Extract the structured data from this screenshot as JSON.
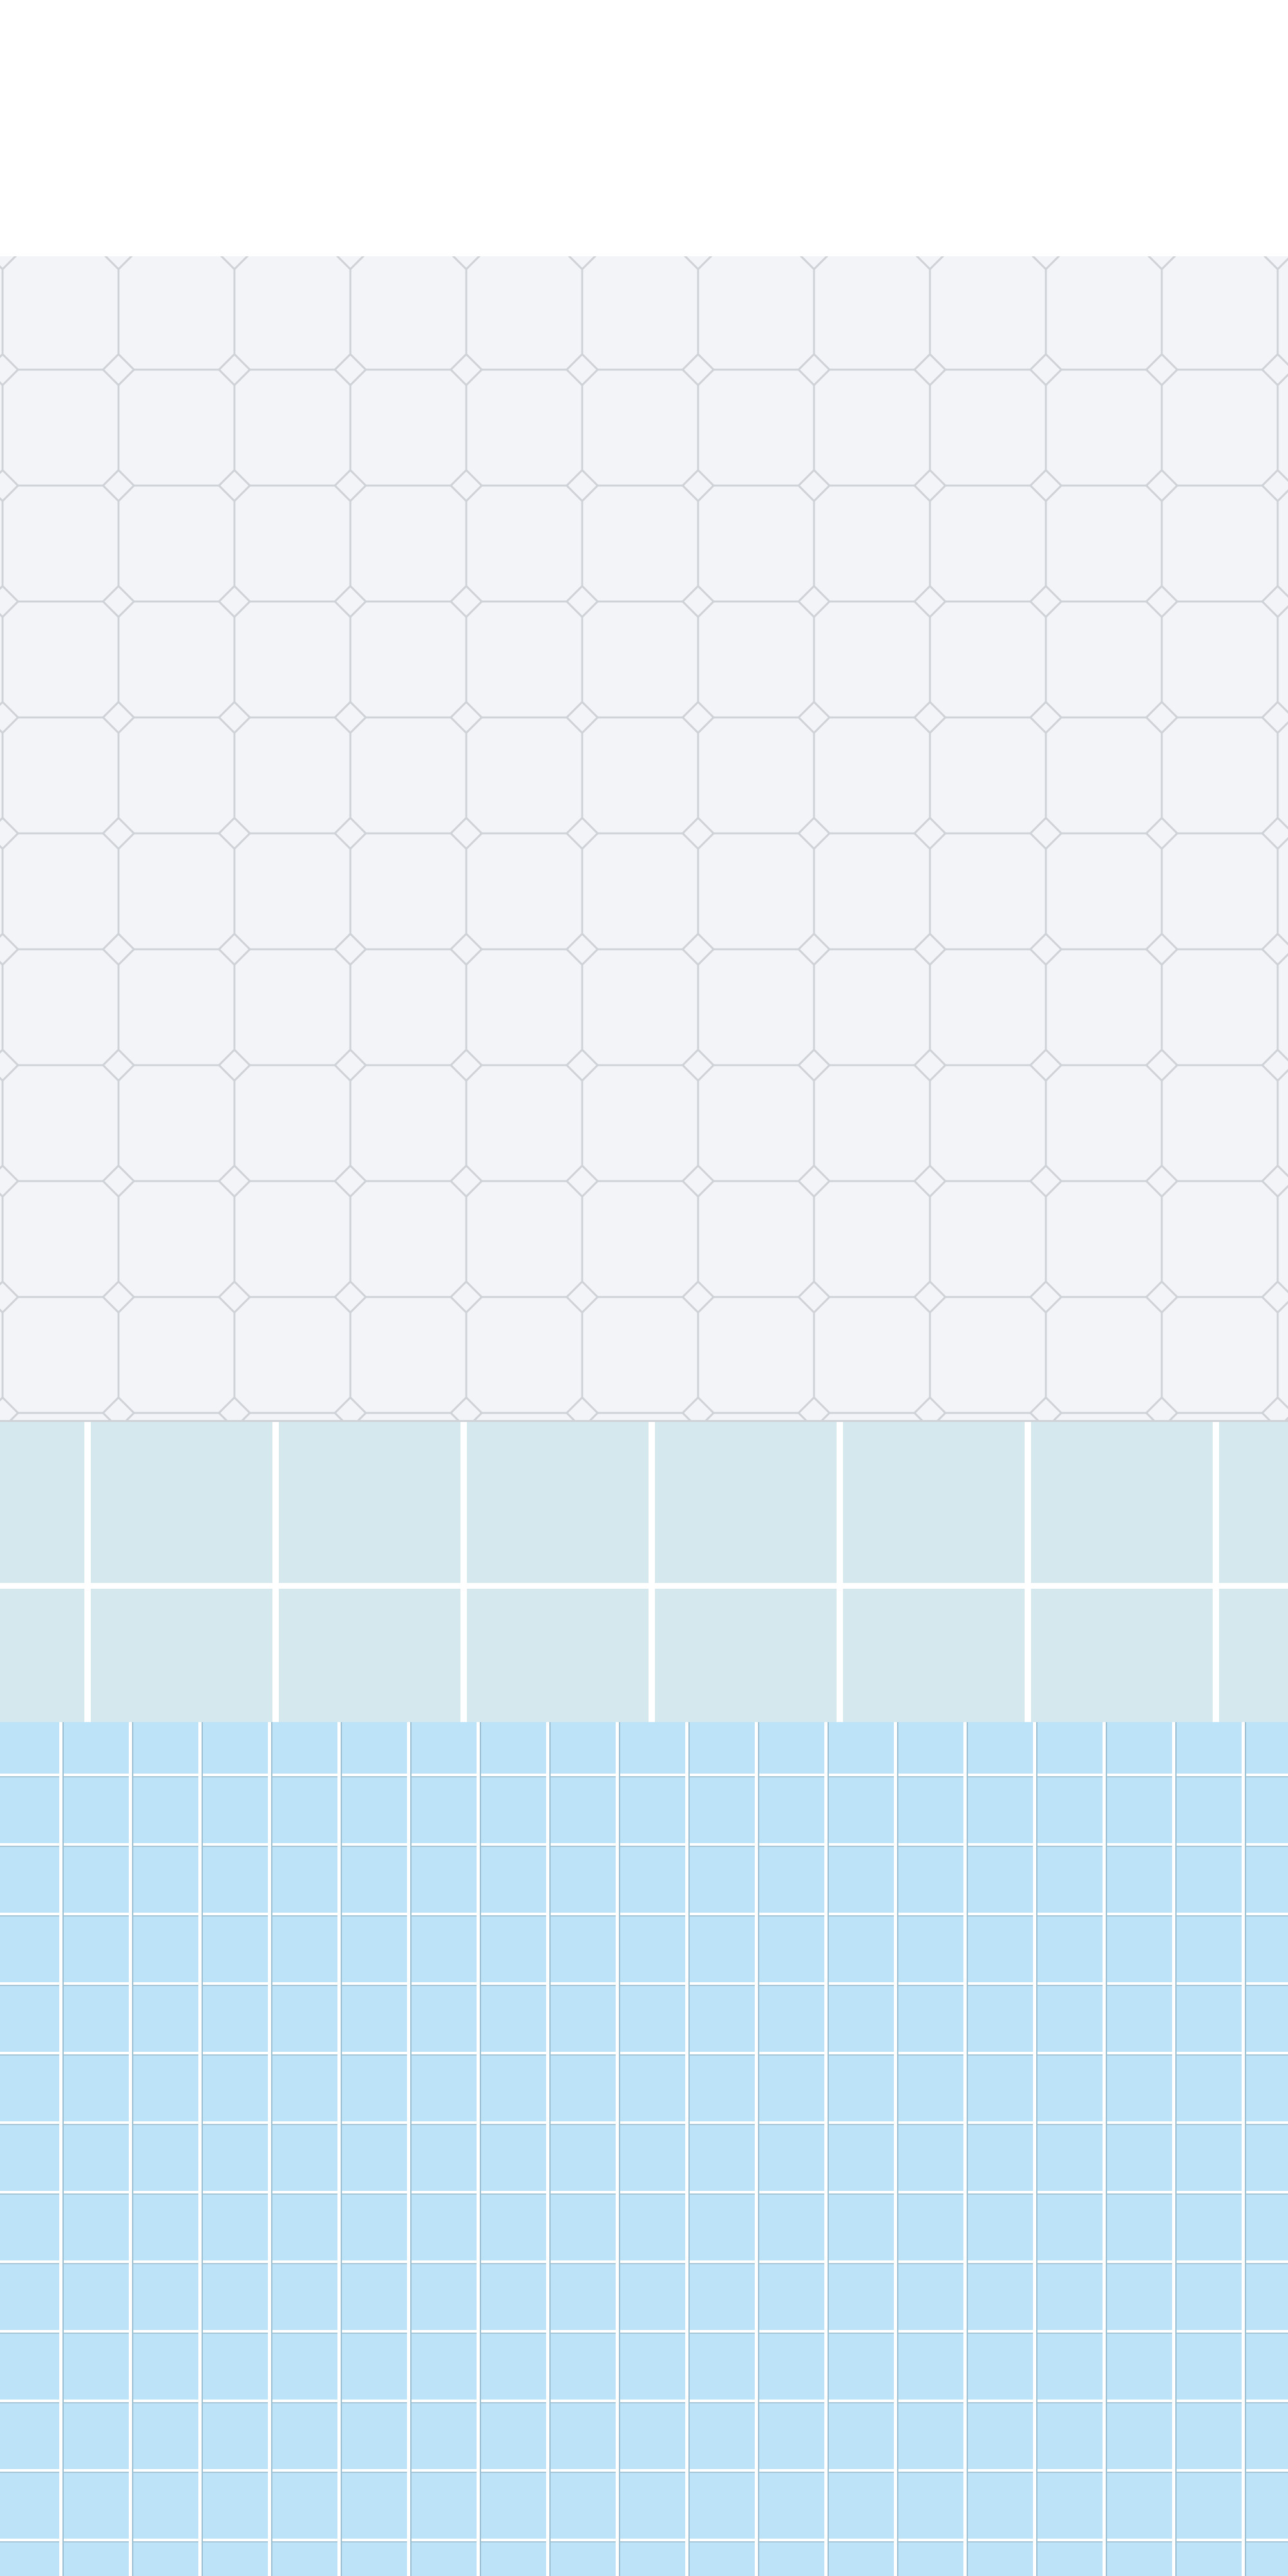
{
  "colors": {
    "top_background": "#ffffff",
    "octagon_background": "#f3f4f8",
    "octagon_line": "#cfd3d8",
    "rect_background": "#d4e8ee",
    "rect_grout": "#ffffff",
    "blue_background": "#bde3f8",
    "blue_grout": "#ffffff",
    "blue_shadow": "#9dbfd2"
  },
  "bands": {
    "top": "blank-area",
    "middle": "octagon-tile-pattern",
    "lower": "rectangular-tile-pattern",
    "bottom": "square-tile-pattern"
  }
}
